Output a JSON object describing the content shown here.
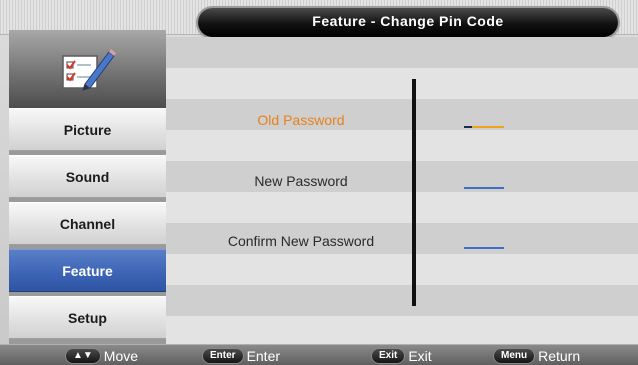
{
  "header": {
    "title": "Feature - Change Pin Code"
  },
  "sidebar": {
    "icon": "checklist-pencil-icon",
    "items": [
      {
        "label": "Picture"
      },
      {
        "label": "Sound"
      },
      {
        "label": "Channel"
      },
      {
        "label": "Feature",
        "active": true
      },
      {
        "label": "Setup"
      }
    ]
  },
  "form": {
    "fields": [
      {
        "label": "Old Password",
        "focused": true
      },
      {
        "label": "New Password"
      },
      {
        "label": "Confirm New Password"
      }
    ]
  },
  "footer": {
    "hints": [
      {
        "key": "▲▼",
        "action": "Move"
      },
      {
        "key": "Enter",
        "action": "Enter"
      },
      {
        "key": "Exit",
        "action": "Exit"
      },
      {
        "key": "Menu",
        "action": "Return"
      }
    ]
  },
  "colors": {
    "active_menu": "#3b63b4",
    "focus_text": "#e8801d",
    "input_underline": "#3d6fc6"
  }
}
